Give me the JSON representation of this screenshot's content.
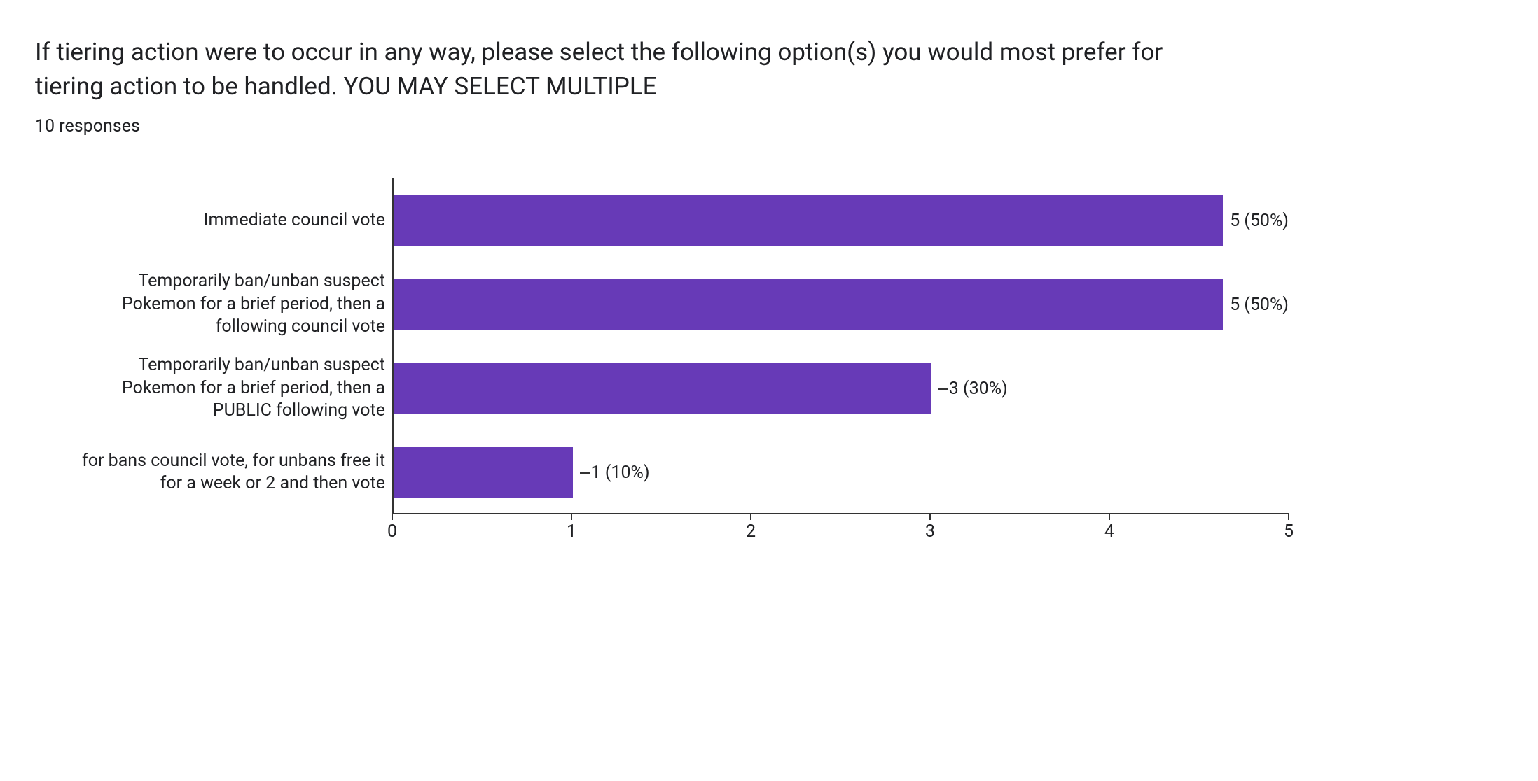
{
  "title": "If tiering action were to occur in any way, please select the following option(s) you would most prefer for tiering action to be handled. YOU MAY SELECT MULTIPLE",
  "subtitle": "10 responses",
  "chart_data": {
    "type": "bar",
    "orientation": "horizontal",
    "categories": [
      "Immediate council vote",
      "Temporarily ban/unban suspect Pokemon for a brief period, then a following council vote",
      "Temporarily ban/unban suspect Pokemon for a brief period, then a PUBLIC following vote",
      "for bans council vote, for unbans free it for a week or 2 and then vote"
    ],
    "values": [
      5,
      5,
      3,
      1
    ],
    "percentages": [
      "50%",
      "50%",
      "30%",
      "10%"
    ],
    "data_labels": [
      "5 (50%)",
      "5 (50%)",
      "3 (30%)",
      "1 (10%)"
    ],
    "xlim": [
      0,
      5
    ],
    "xticks": [
      0,
      1,
      2,
      3,
      4,
      5
    ],
    "color": "#673ab7",
    "title": "",
    "xlabel": "",
    "ylabel": ""
  }
}
